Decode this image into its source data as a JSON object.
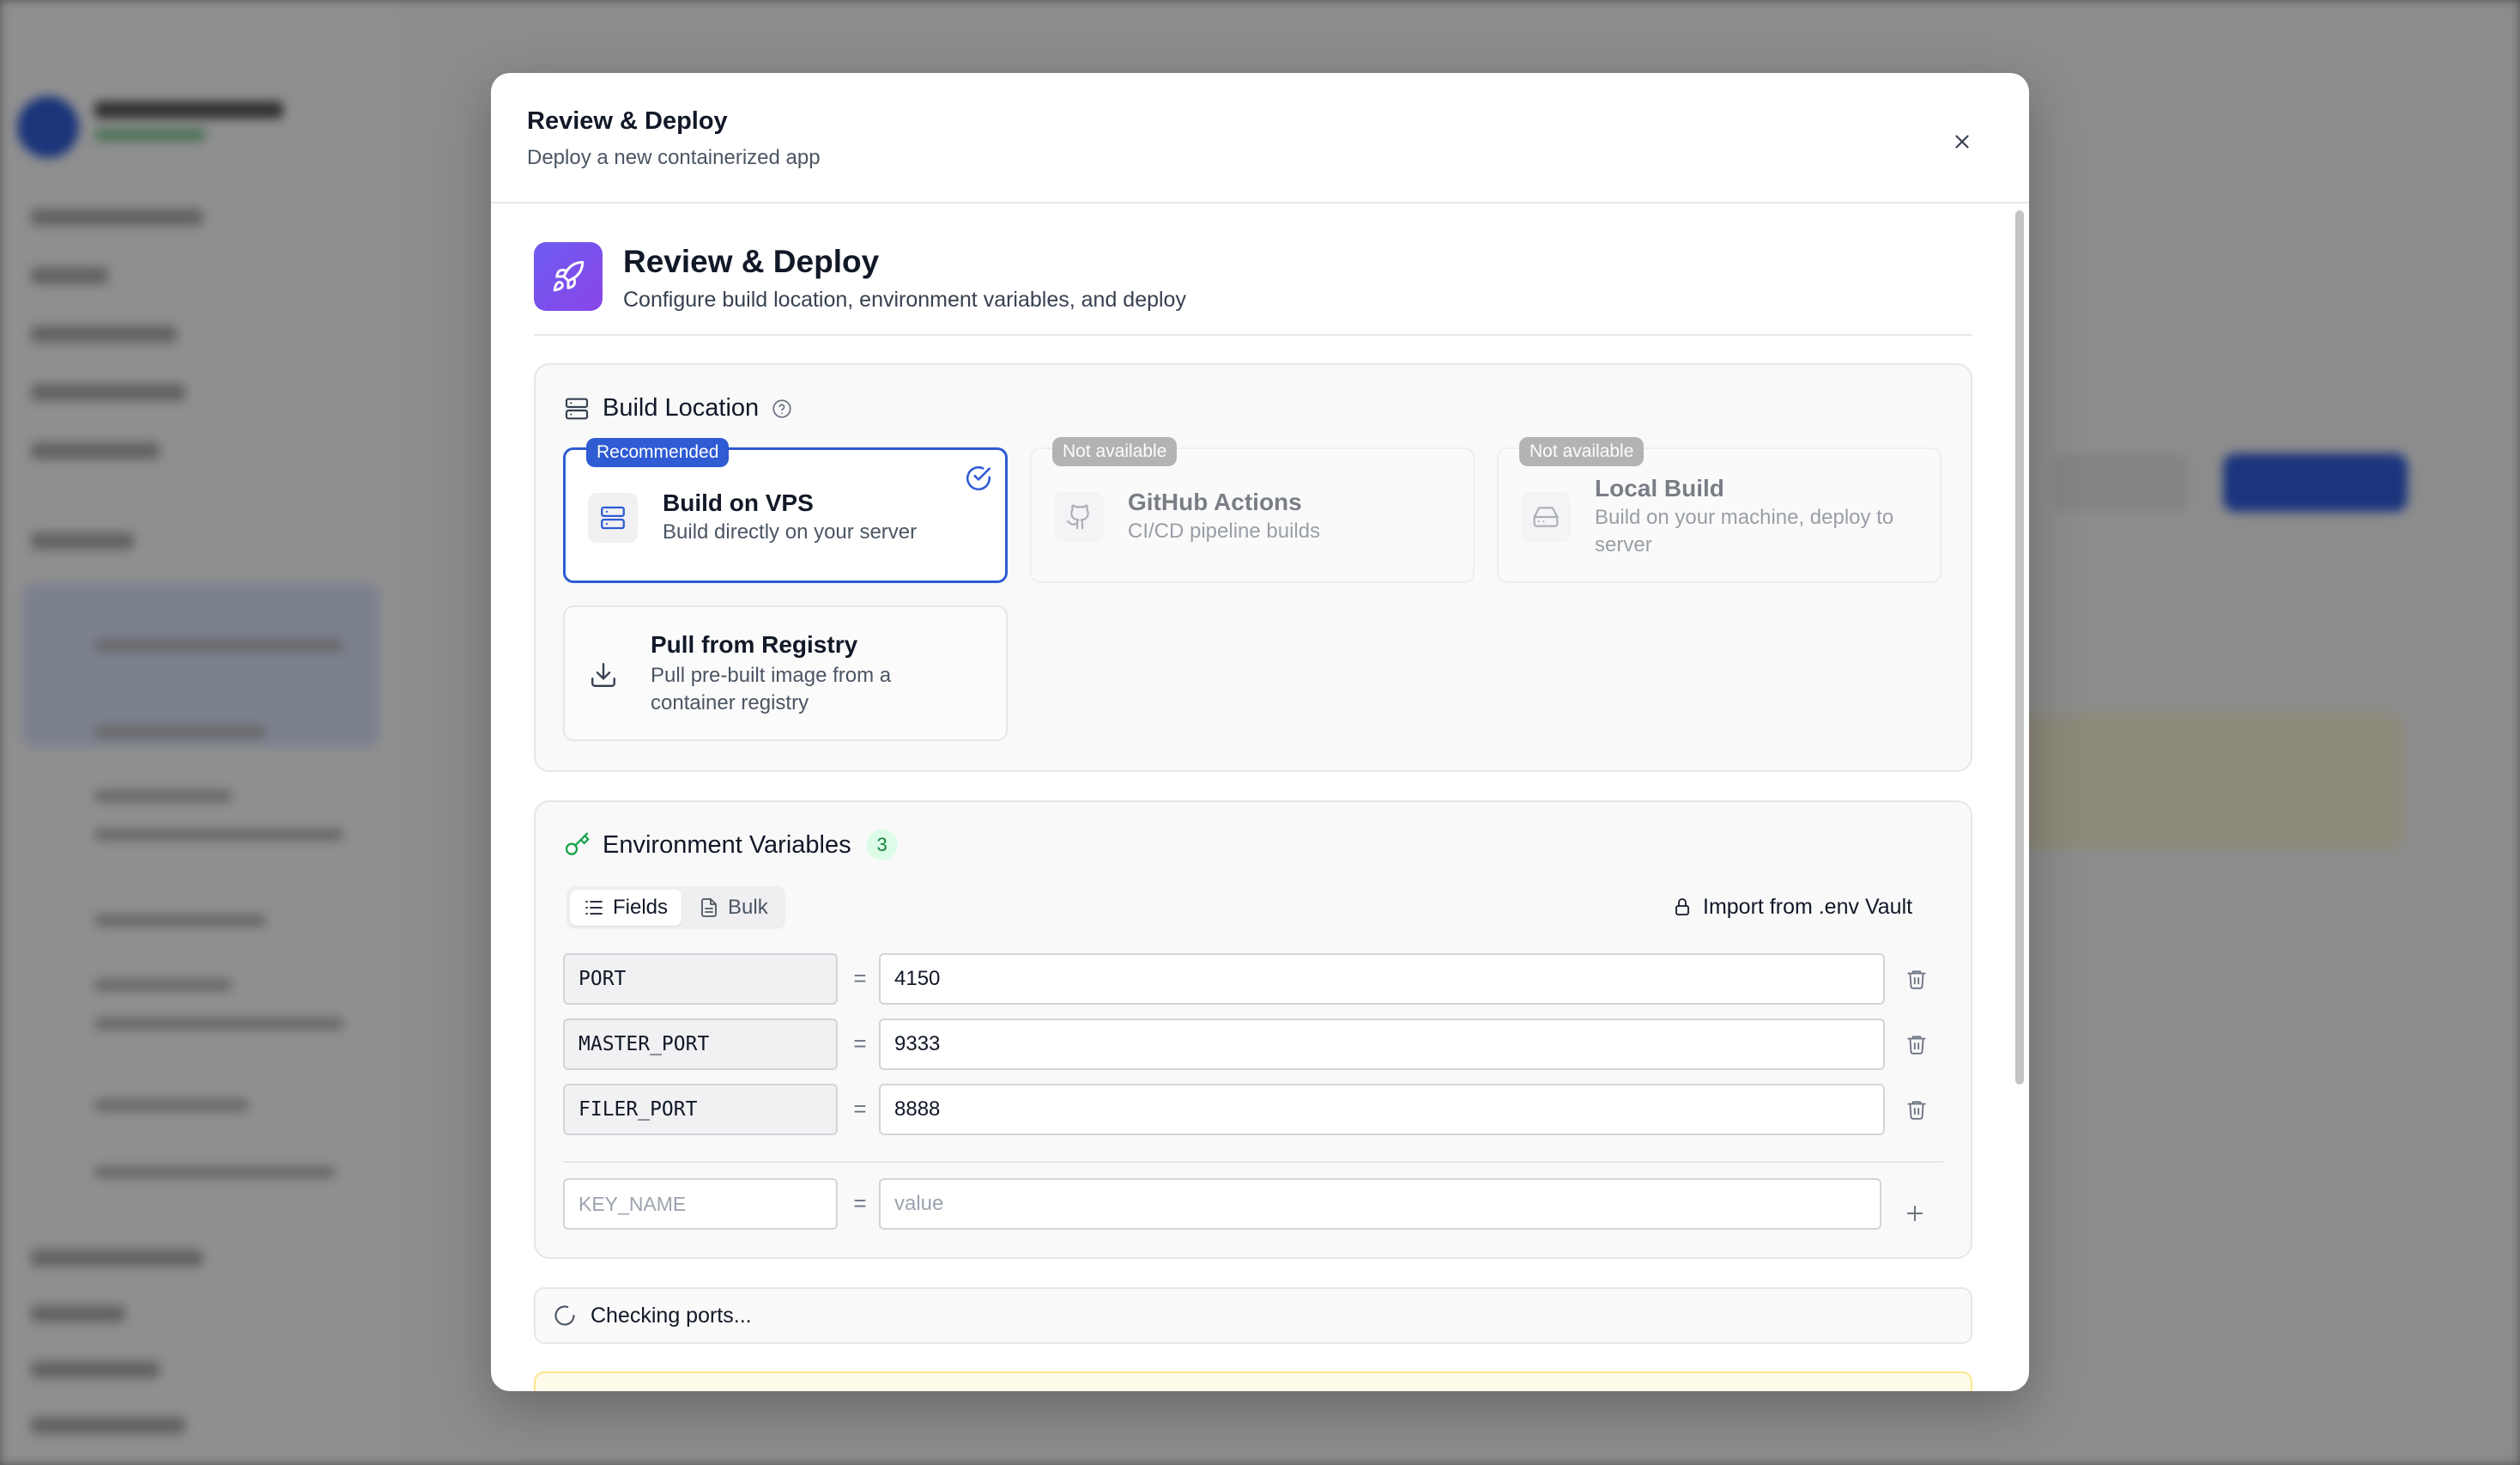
{
  "modal": {
    "title": "Review & Deploy",
    "subtitle": "Deploy a new containerized app",
    "close_icon": "close-icon"
  },
  "section": {
    "icon": "rocket-icon",
    "title": "Review & Deploy",
    "subtitle": "Configure build location, environment variables, and deploy"
  },
  "build_location": {
    "label": "Build Location",
    "icon": "server-icon",
    "help_icon": "help-circle-icon",
    "options": [
      {
        "title": "Build on VPS",
        "description": "Build directly on your server",
        "badge": "Recommended",
        "selected": true,
        "available": true,
        "icon": "server-icon"
      },
      {
        "title": "GitHub Actions",
        "description": "CI/CD pipeline builds",
        "badge": "Not available",
        "selected": false,
        "available": false,
        "icon": "github-icon"
      },
      {
        "title": "Local Build",
        "description": "Build on your machine, deploy to server",
        "badge": "Not available",
        "selected": false,
        "available": false,
        "icon": "hard-drive-icon"
      },
      {
        "title": "Pull from Registry",
        "description": "Pull pre-built image from a container registry",
        "badge": "",
        "selected": false,
        "available": true,
        "icon": "download-icon"
      }
    ]
  },
  "env": {
    "label": "Environment Variables",
    "count": "3",
    "icon": "key-icon",
    "modes": [
      {
        "label": "Fields",
        "active": true
      },
      {
        "label": "Bulk",
        "active": false
      }
    ],
    "import_label": "Import from .env Vault",
    "rows": [
      {
        "key": "PORT",
        "value": "4150"
      },
      {
        "key": "MASTER_PORT",
        "value": "9333"
      },
      {
        "key": "FILER_PORT",
        "value": "8888"
      }
    ],
    "separator": "=",
    "new_key_placeholder": "KEY_NAME",
    "new_value_placeholder": "value"
  },
  "status": {
    "text": "Checking ports...",
    "icon": "loader-icon"
  },
  "colors": {
    "accent": "#2f5bd3",
    "rocket_gradient_start": "#6d5cf0",
    "rocket_gradient_end": "#8a45e8",
    "success": "#16a34a"
  }
}
